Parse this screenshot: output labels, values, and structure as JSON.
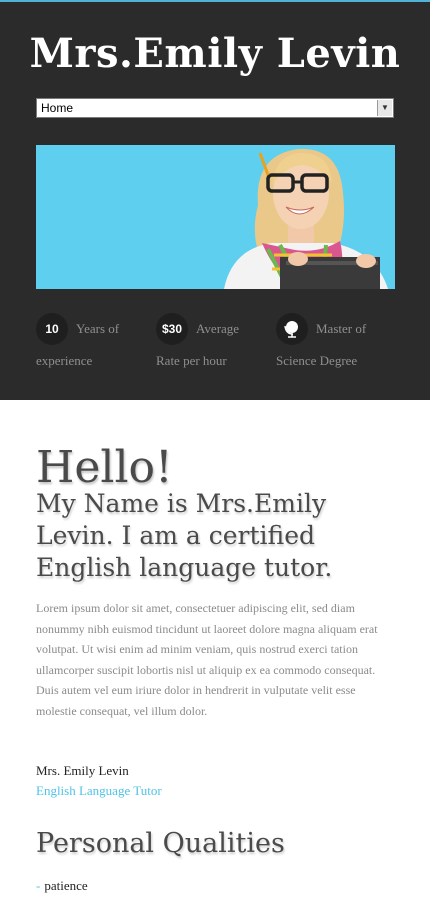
{
  "header": {
    "site_title": "Mrs.Emily Levin",
    "nav_selected": "Home"
  },
  "stats": [
    {
      "badge": "10",
      "line1": "Years of",
      "line2": "experience"
    },
    {
      "badge": "$30",
      "line1": "Average",
      "line2": "Rate per hour"
    },
    {
      "badge_icon": "globe-icon",
      "line1": "Master of",
      "line2": "Science Degree"
    }
  ],
  "main": {
    "hello": "Hello!",
    "intro": "My Name is Mrs.Emily Levin. I am a certified English language tutor.",
    "lorem": "Lorem ipsum dolor sit amet, consectetuer adipiscing elit, sed diam nonummy nibh euismod tincidunt ut laoreet dolore magna aliquam erat volutpat. Ut wisi enim ad minim veniam, quis nostrud exerci tation ullamcorper suscipit lobortis nisl ut aliquip ex ea commodo consequat. Duis autem vel eum iriure dolor in hendrerit in vulputate velit esse molestie consequat, vel illum dolor.",
    "signature_name": "Mrs. Emily Levin",
    "signature_role": "English Language Tutor",
    "qualities_title": "Personal Qualities",
    "qualities": [
      "patience"
    ]
  },
  "colors": {
    "accent": "#4fc3e6",
    "header_bg": "#2b2b2b",
    "hero_bg": "#5ecfee"
  }
}
